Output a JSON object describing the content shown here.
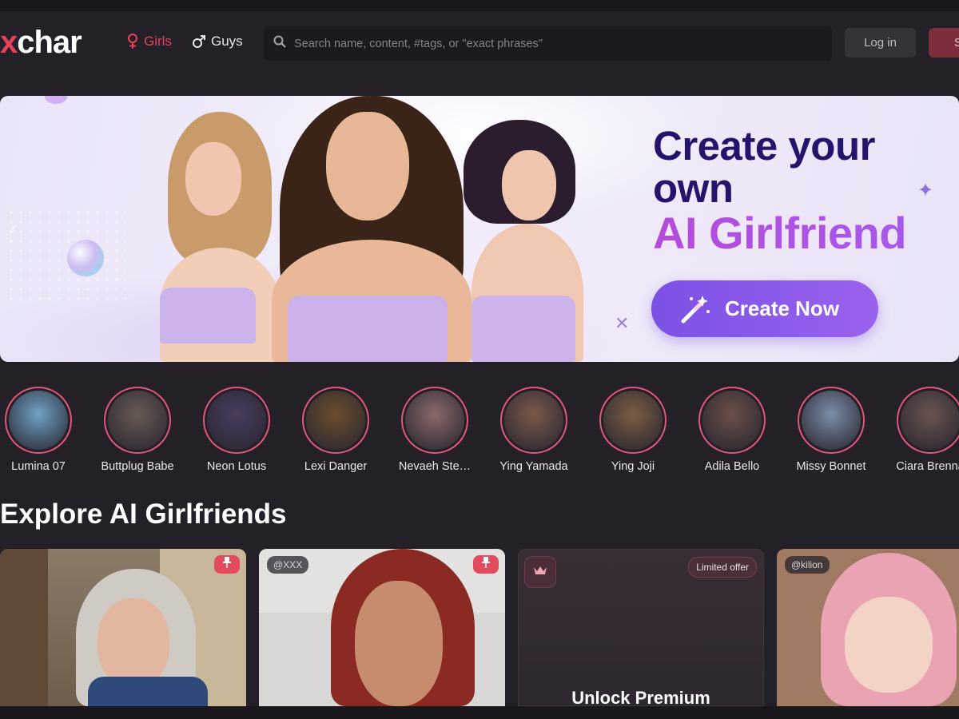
{
  "header": {
    "logo_x": "x",
    "logo_rest": "char",
    "nav": {
      "girls": "Girls",
      "guys": "Guys"
    },
    "search_placeholder": "Search name, content, #tags, or \"exact phrases\"",
    "login": "Log in",
    "signup": "S"
  },
  "banner": {
    "headline_line1": "Create your",
    "headline_line2": "own",
    "headline_line3": "AI Girlfriend",
    "cta": "Create Now",
    "prev_arrow": "‹",
    "close_mark": "✕",
    "sparkle": "✦"
  },
  "stories": [
    {
      "name": "Lumina 07",
      "color": "#6fa3c8"
    },
    {
      "name": "Buttplug Babe",
      "color": "#6a5a55"
    },
    {
      "name": "Neon Lotus",
      "color": "#4a3c5e"
    },
    {
      "name": "Lexi Danger",
      "color": "#6b4f2e"
    },
    {
      "name": "Nevaeh Ste…",
      "color": "#8a6a6a"
    },
    {
      "name": "Ying Yamada",
      "color": "#7a5a4a"
    },
    {
      "name": "Ying Joji",
      "color": "#7a5e44"
    },
    {
      "name": "Adila Bello",
      "color": "#6b5048"
    },
    {
      "name": "Missy Bonnet",
      "color": "#7a8ea8"
    },
    {
      "name": "Ciara Brenna",
      "color": "#6a5550"
    }
  ],
  "section_title": "Explore AI Girlfriends",
  "cards": [
    {
      "tag": ""
    },
    {
      "tag": "@XXX"
    },
    {
      "offer": "Limited offer",
      "title": "Unlock Premium"
    },
    {
      "tag": "@kilion"
    }
  ],
  "colors": {
    "accent": "#e5425a",
    "background": "#232127",
    "cta": "#7b51e5"
  },
  "icons": [
    "female-icon",
    "male-icon",
    "search-icon",
    "pin-icon",
    "crown-icon",
    "magic-wand-icon"
  ]
}
